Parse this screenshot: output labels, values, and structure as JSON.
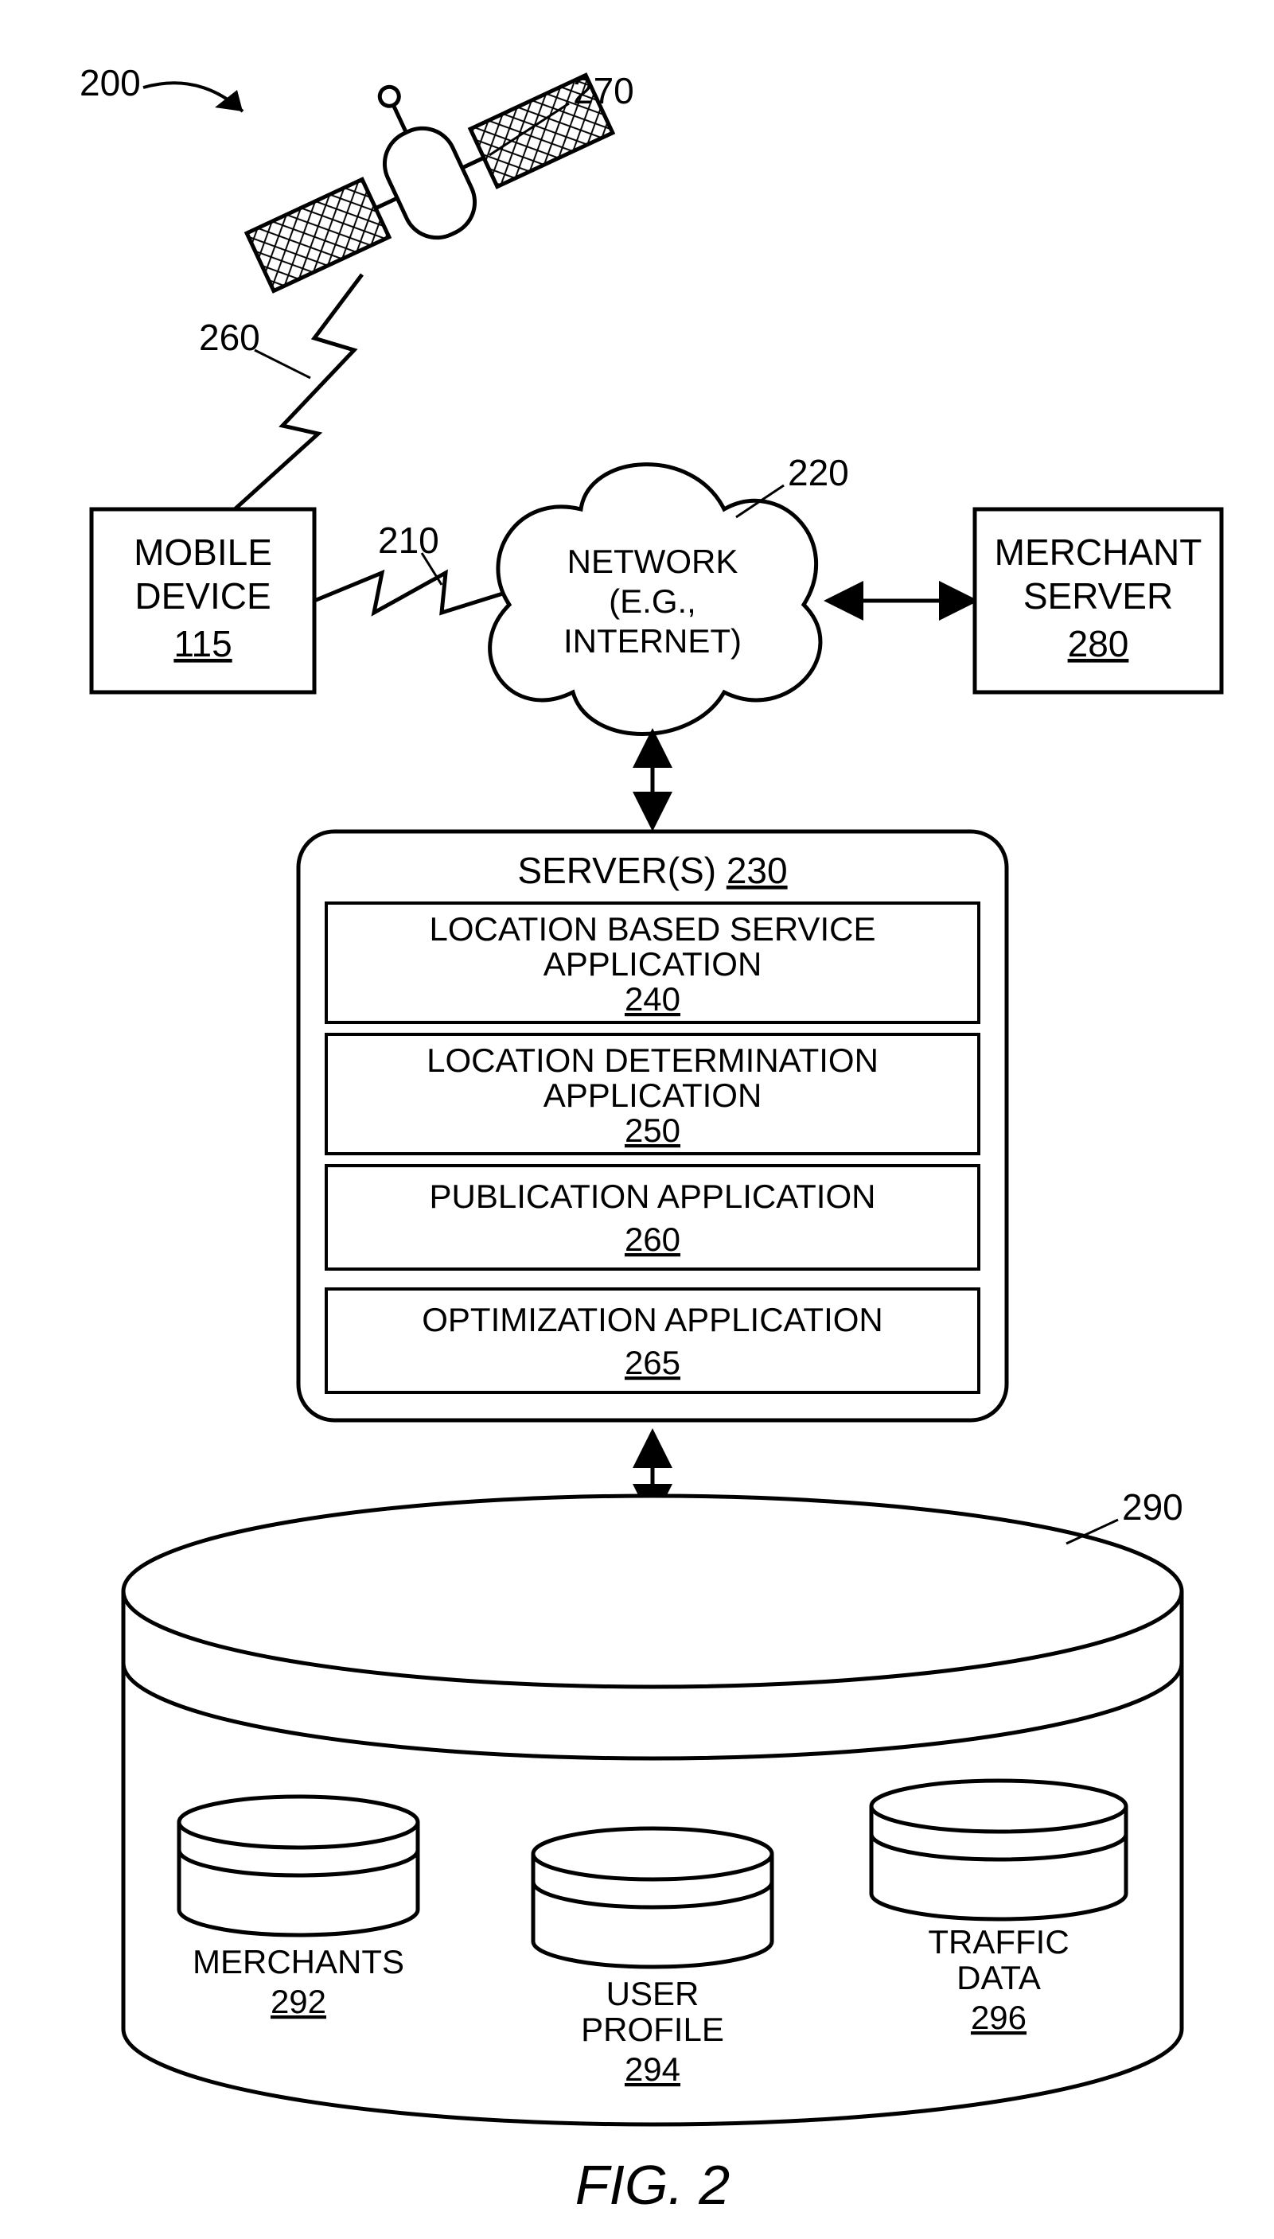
{
  "figure_label": "FIG. 2",
  "system_ref": "200",
  "satellite": {
    "ref": "270"
  },
  "sat_link": {
    "ref": "260"
  },
  "mobile_device": {
    "label1": "MOBILE",
    "label2": "DEVICE",
    "ref": "115"
  },
  "wireless_link": {
    "ref": "210"
  },
  "network": {
    "label1": "NETWORK",
    "label2": "(E.G.,",
    "label3": "INTERNET)",
    "ref": "220"
  },
  "merchant_server": {
    "label1": "MERCHANT",
    "label2": "SERVER",
    "ref": "280"
  },
  "servers": {
    "title": "SERVER(S)",
    "ref": "230",
    "lbs": {
      "label1": "LOCATION BASED SERVICE",
      "label2": "APPLICATION",
      "ref": "240"
    },
    "loc_det": {
      "label1": "LOCATION DETERMINATION",
      "label2": "APPLICATION",
      "ref": "250"
    },
    "pub": {
      "label1": "PUBLICATION APPLICATION",
      "ref": "260"
    },
    "opt": {
      "label1": "OPTIMIZATION APPLICATION",
      "ref": "265"
    }
  },
  "db": {
    "ref": "290",
    "merchants": {
      "label": "MERCHANTS",
      "ref": "292"
    },
    "user_profile": {
      "label1": "USER",
      "label2": "PROFILE",
      "ref": "294"
    },
    "traffic": {
      "label1": "TRAFFIC",
      "label2": "DATA",
      "ref": "296"
    }
  }
}
